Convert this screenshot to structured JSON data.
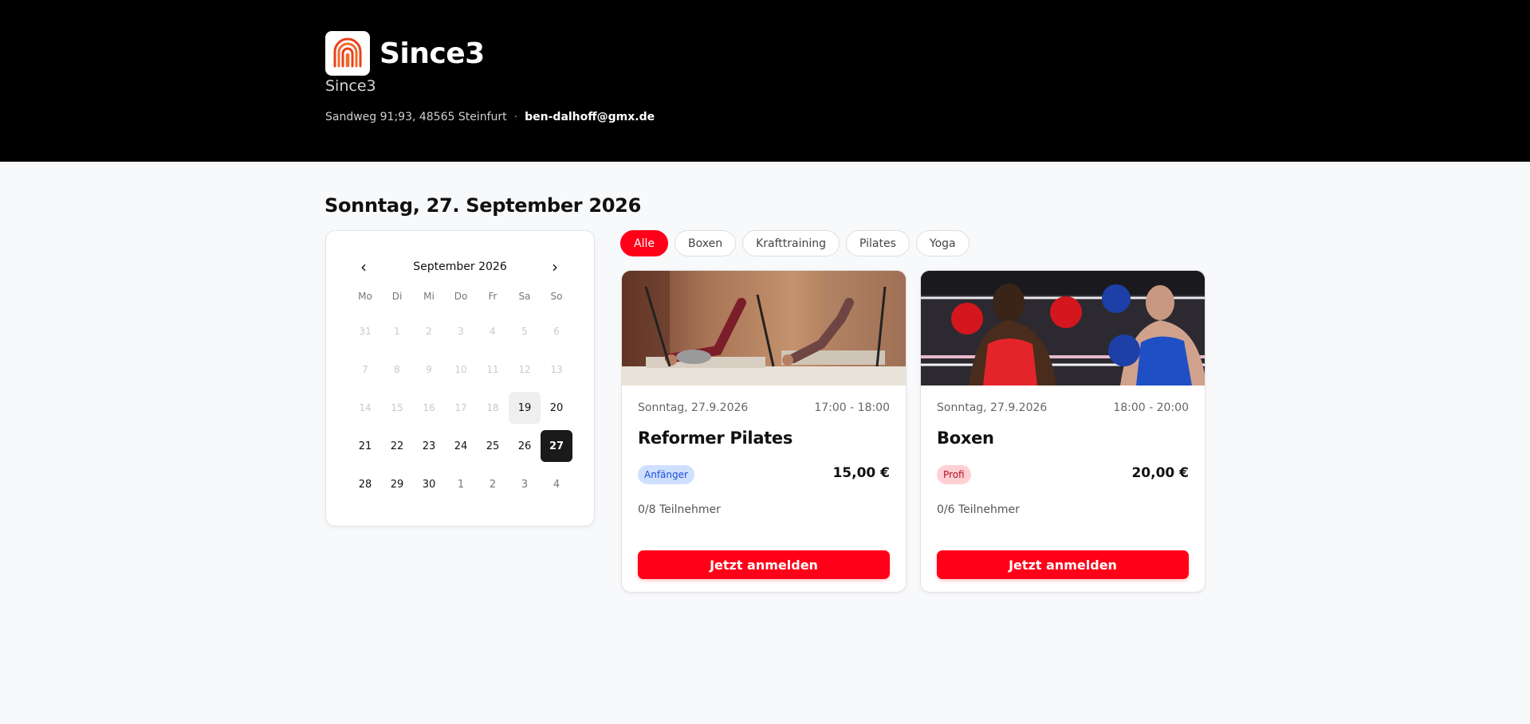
{
  "studio": {
    "name": "Since3",
    "subtitle": "Since3",
    "address": "Sandweg 91;93, 48565 Steinfurt",
    "separator": "·",
    "email": "ben-dalhoff@gmx.de"
  },
  "selected_date_title": "Sonntag, 27. September 2026",
  "calendar": {
    "prev_label": "‹",
    "next_label": "›",
    "month_label": "September 2026",
    "weekdays": [
      "Mo",
      "Di",
      "Mi",
      "Do",
      "Fr",
      "Sa",
      "So"
    ],
    "weeks": [
      [
        "31",
        "1",
        "2",
        "3",
        "4",
        "5",
        "6"
      ],
      [
        "7",
        "8",
        "9",
        "10",
        "11",
        "12",
        "13"
      ],
      [
        "14",
        "15",
        "16",
        "17",
        "18",
        "19",
        "20"
      ],
      [
        "21",
        "22",
        "23",
        "24",
        "25",
        "26",
        "27"
      ],
      [
        "28",
        "29",
        "30",
        "1",
        "2",
        "3",
        "4"
      ]
    ]
  },
  "filters": [
    "Alle",
    "Boxen",
    "Krafttraining",
    "Pilates",
    "Yoga"
  ],
  "courses": [
    {
      "date": "Sonntag, 27.9.2026",
      "time": "17:00 - 18:00",
      "title": "Reformer Pilates",
      "level": "Anfänger",
      "price": "15,00 €",
      "participants": "0/8 Teilnehmer",
      "button": "Jetzt anmelden"
    },
    {
      "date": "Sonntag, 27.9.2026",
      "time": "18:00 - 20:00",
      "title": "Boxen",
      "level": "Profi",
      "price": "20,00 €",
      "participants": "0/6 Teilnehmer",
      "button": "Jetzt anmelden"
    }
  ],
  "colors": {
    "accent": "#ff0018",
    "header_bg": "#000000",
    "page_bg": "#f8f9fb",
    "selected_day": "#1a1a1a"
  }
}
